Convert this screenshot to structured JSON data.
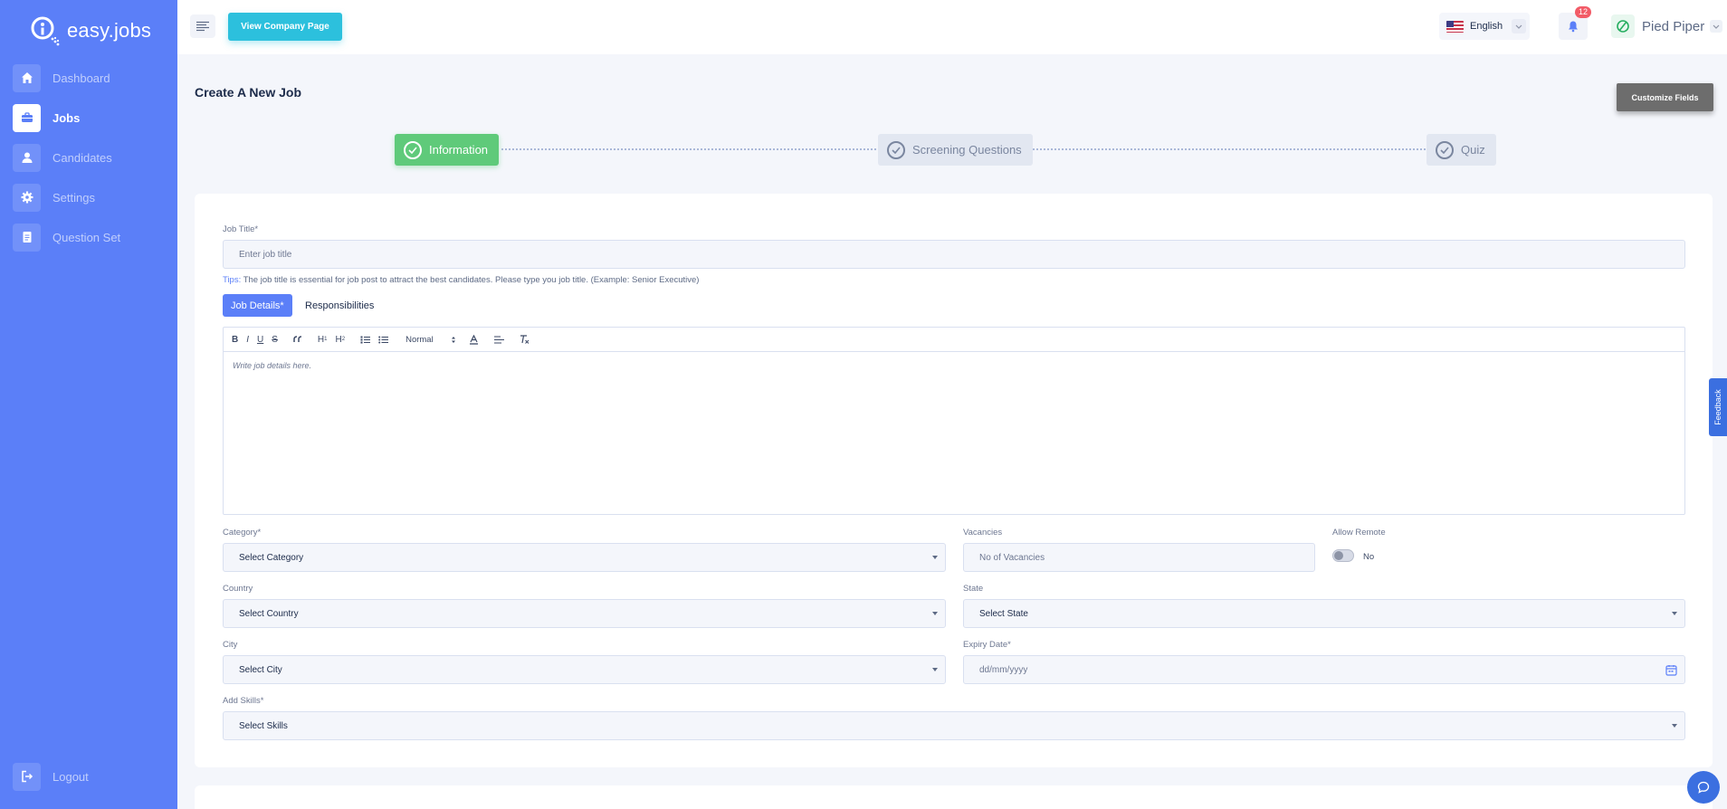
{
  "app": {
    "logo_text": "easy.jobs"
  },
  "sidebar": {
    "items": [
      {
        "label": "Dashboard"
      },
      {
        "label": "Jobs"
      },
      {
        "label": "Candidates"
      },
      {
        "label": "Settings"
      },
      {
        "label": "Question Set"
      }
    ],
    "logout_label": "Logout"
  },
  "header": {
    "view_company_label": "View Company Page",
    "language": "English",
    "notification_count": "12",
    "company_name": "Pied Piper"
  },
  "page": {
    "title": "Create A New Job",
    "customize_label": "Customize Fields"
  },
  "steps": [
    {
      "label": "Information",
      "state": "active"
    },
    {
      "label": "Screening Questions",
      "state": "inactive"
    },
    {
      "label": "Quiz",
      "state": "inactive"
    }
  ],
  "form": {
    "job_title": {
      "label": "Job Title*",
      "placeholder": "Enter  job title"
    },
    "tips": {
      "key": "Tips:",
      "text": " The job title is essential for job post to attract the best candidates. Please type you job title. (Example: Senior Executive)"
    },
    "tabs": {
      "details": "Job Details*",
      "responsibilities": "Responsibilities"
    },
    "editor": {
      "format": "Normal",
      "placeholder": "Write job details here."
    },
    "category": {
      "label": "Category*",
      "value": "Select Category"
    },
    "vacancies": {
      "label": "Vacancies",
      "placeholder": "No of Vacancies"
    },
    "remote": {
      "label": "Allow Remote",
      "value": "No"
    },
    "country": {
      "label": "Country",
      "value": "Select Country"
    },
    "state": {
      "label": "State",
      "value": "Select State"
    },
    "city": {
      "label": "City",
      "value": "Select City"
    },
    "expiry": {
      "label": "Expiry Date*",
      "placeholder": "dd/mm/yyyy"
    },
    "skills": {
      "label": "Add Skills*",
      "value": "Select Skills"
    }
  },
  "widgets": {
    "feedback_label": "Feedback"
  },
  "colors": {
    "primary": "#5b7ff8",
    "accent": "#2cc0dd",
    "success": "#5fca7a",
    "danger": "#f25b67"
  }
}
